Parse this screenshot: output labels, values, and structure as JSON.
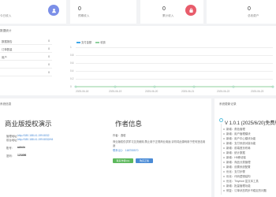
{
  "stats": [
    {
      "value": "",
      "label": "今日收入",
      "color": "#7b8fe8",
      "icon": "user-icon"
    },
    {
      "value": "0",
      "label": "预期收入",
      "color": "#8a7cf0",
      "icon": "calendar-icon"
    },
    {
      "value": "0",
      "label": "累计收入",
      "color": "#ffffff",
      "icon": ""
    },
    {
      "value": "0",
      "label": "总收费户",
      "color": "#e85c6b",
      "icon": "bag-icon"
    }
  ],
  "chart_panel": {
    "title": "数据统计",
    "side_items": [
      {
        "label": "数据报告",
        "value": "0"
      },
      {
        "label": "订单数量",
        "value": "0"
      },
      {
        "label": "用户",
        "value": "0"
      },
      {
        "label": "",
        "value": "0"
      },
      {
        "label": "",
        "value": "0"
      }
    ]
  },
  "chart_data": {
    "type": "line",
    "series": [
      {
        "name": "支付金额",
        "color": "#3fa7e8",
        "values": [
          0,
          0,
          0,
          0,
          0,
          0
        ]
      },
      {
        "name": "收费",
        "color": "#8fd19e",
        "values": [
          0,
          0,
          0,
          0,
          0,
          0
        ]
      }
    ],
    "x": [
      "2025-06-18",
      "2025-06-19",
      "2025-06-20",
      "2025-06-21",
      "2025-06-22",
      "2025-06-23"
    ],
    "yticks": [
      "1",
      "0.8",
      "0.6",
      "0.4",
      "0.2",
      "0"
    ],
    "ylim": [
      0,
      1
    ],
    "legend": "top-left"
  },
  "info_panel": {
    "section_title": "系统信息",
    "title": "商业版授权演示",
    "rows": [
      {
        "label": "管理地址:",
        "value": "http://180.188.41.199:8032"
      },
      {
        "label": "前台地址:",
        "value": "http://180.188.41.199:8032/h5"
      },
      {
        "label": "账号:",
        "value": "admin"
      },
      {
        "label": "密码:",
        "value": "123456"
      }
    ]
  },
  "author_panel": {
    "title": "作者信息",
    "lines": [
      "作者：逸晗",
      "商业版权仅供学习交流使用,禁止用于正规商业用途,请勿将此源码用于任何违法用途",
      "联系QQ：  168755570"
    ],
    "buttons": [
      "联系作者QQ",
      "购买正版"
    ]
  },
  "changelog": {
    "section_title": "系统更新记录",
    "title": "V 1.0.1 (2025/6/20)免费版本",
    "items": [
      "新增：角色管理",
      "新增：用户管理模块",
      "新增：用户中心模块功能",
      "新增：支付系统对接功能",
      "新增：前端首页布局",
      "新增：统计数据",
      "新增：H5移动端",
      "新增：商品分类管理",
      "新增：设置系统配置",
      "优化：支付步骤",
      "优化：代码逻辑结构",
      "优化：Tinymce 富文本工具",
      "新增：批量管理功能",
      "修复：订单状态同步不稳定的问题"
    ]
  }
}
